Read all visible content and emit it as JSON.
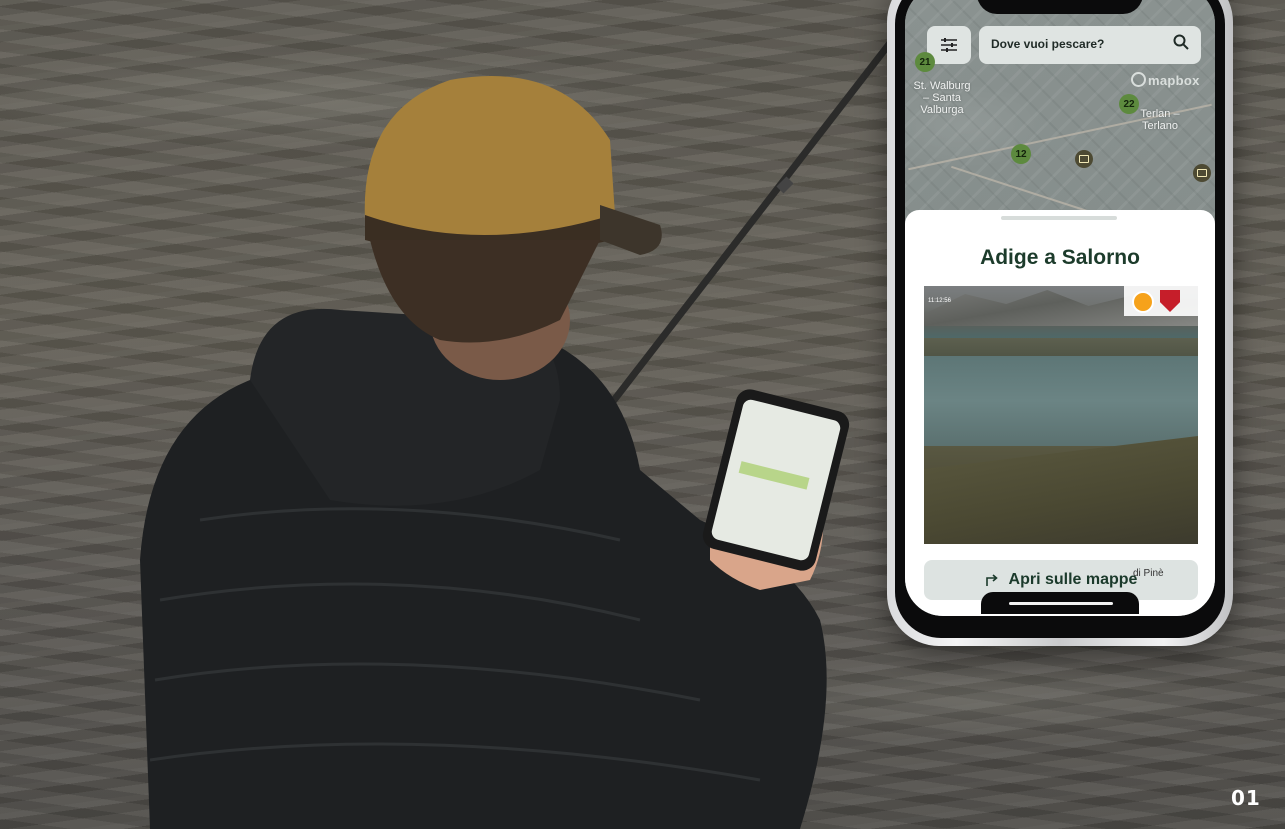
{
  "search": {
    "placeholder": "Dove vuoi pescare?"
  },
  "map": {
    "attribution": "mapbox",
    "markers": [
      "21",
      "22",
      "12"
    ],
    "places": {
      "st_walburg": [
        "St. Walburg",
        "– Santa",
        "Valburga"
      ],
      "terlan": [
        "Terlan –",
        "Terlano"
      ],
      "bottom": "di Pinè"
    }
  },
  "sheet": {
    "title": "Adige a Salorno",
    "webcam_timestamp": "11:12:56",
    "open_maps_label": "Apri sulle mappe"
  },
  "page_badge": "01",
  "colors": {
    "accent_green": "#1c3b2b",
    "marker_green": "#5d8a3e",
    "button_bg": "#dde3e1"
  }
}
